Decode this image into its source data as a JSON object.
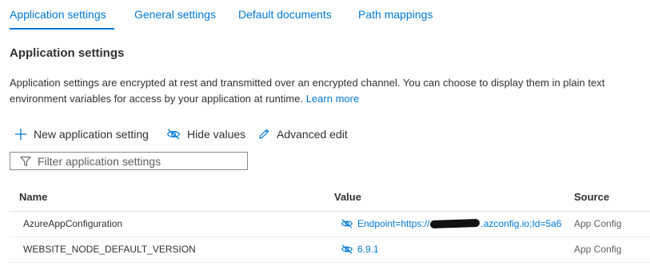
{
  "tabs": [
    {
      "label": "Application settings",
      "active": true
    },
    {
      "label": "General settings",
      "active": false
    },
    {
      "label": "Default documents",
      "active": false
    },
    {
      "label": "Path mappings",
      "active": false
    }
  ],
  "section_title": "Application settings",
  "description": {
    "line1": "Application settings are encrypted at rest and transmitted over an encrypted channel. You can choose to display them in plain text",
    "line2": "environment variables for access by your application at runtime.",
    "link": "Learn more"
  },
  "commands": {
    "new_setting": "New application setting",
    "hide_values": "Hide values",
    "advanced_edit": "Advanced edit"
  },
  "filter": {
    "placeholder": "Filter application settings",
    "value": ""
  },
  "table": {
    "headers": {
      "name": "Name",
      "value": "Value",
      "source": "Source"
    },
    "rows": [
      {
        "name": "AzureAppConfiguration",
        "value_prefix": "Endpoint=https://",
        "value_suffix": ".azconfig.io;Id=5a6",
        "source": "App Config"
      },
      {
        "name": "WEBSITE_NODE_DEFAULT_VERSION",
        "value": "6.9.1",
        "source": "App Config"
      }
    ]
  },
  "colors": {
    "accent": "#0078d4",
    "text": "#323130",
    "muted": "#605e5c"
  }
}
